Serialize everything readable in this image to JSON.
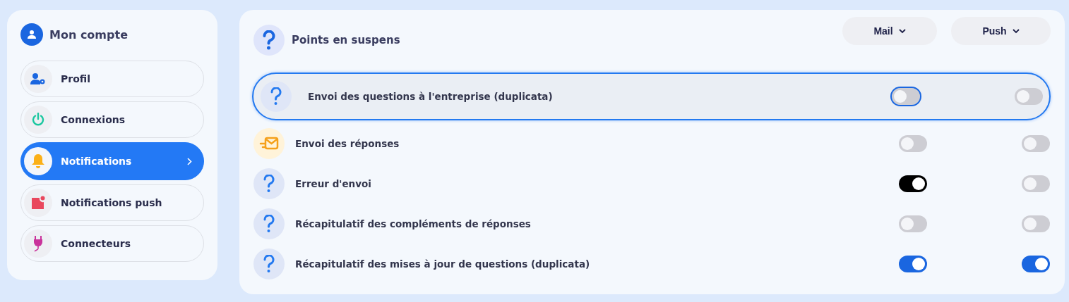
{
  "sidebar": {
    "title": "Mon compte",
    "items": [
      {
        "label": "Profil",
        "kind": "profile",
        "selected": false
      },
      {
        "label": "Connexions",
        "kind": "connections",
        "selected": false
      },
      {
        "label": "Notifications",
        "kind": "notifications",
        "selected": true
      },
      {
        "label": "Notifications push",
        "kind": "push",
        "selected": false
      },
      {
        "label": "Connecteurs",
        "kind": "connectors",
        "selected": false
      }
    ]
  },
  "panel": {
    "title": "Points en suspens",
    "channels": [
      {
        "label": "Mail"
      },
      {
        "label": "Push"
      }
    ],
    "rows": [
      {
        "label": "Envoi des questions à l'entreprise (duplicata)",
        "kind": "question",
        "focused": true,
        "mail": {
          "on": false,
          "focused": true
        },
        "push": {
          "on": false,
          "focused": false
        }
      },
      {
        "label": "Envoi des réponses",
        "kind": "mail",
        "focused": false,
        "mail": {
          "on": false,
          "focused": false
        },
        "push": {
          "on": false,
          "focused": false
        }
      },
      {
        "label": "Erreur d'envoi",
        "kind": "question",
        "focused": false,
        "mail": {
          "on": true,
          "focused": false,
          "color": "#000000"
        },
        "push": {
          "on": false,
          "focused": false
        }
      },
      {
        "label": "Récapitulatif des compléments de réponses",
        "kind": "question",
        "focused": false,
        "mail": {
          "on": false,
          "focused": false
        },
        "push": {
          "on": false,
          "focused": false
        }
      },
      {
        "label": "Récapitulatif des mises à jour de questions (duplicata)",
        "kind": "question",
        "focused": false,
        "mail": {
          "on": true,
          "focused": false,
          "color": "#1a66e0"
        },
        "push": {
          "on": true,
          "focused": false,
          "color": "#1a66e0"
        }
      }
    ]
  }
}
